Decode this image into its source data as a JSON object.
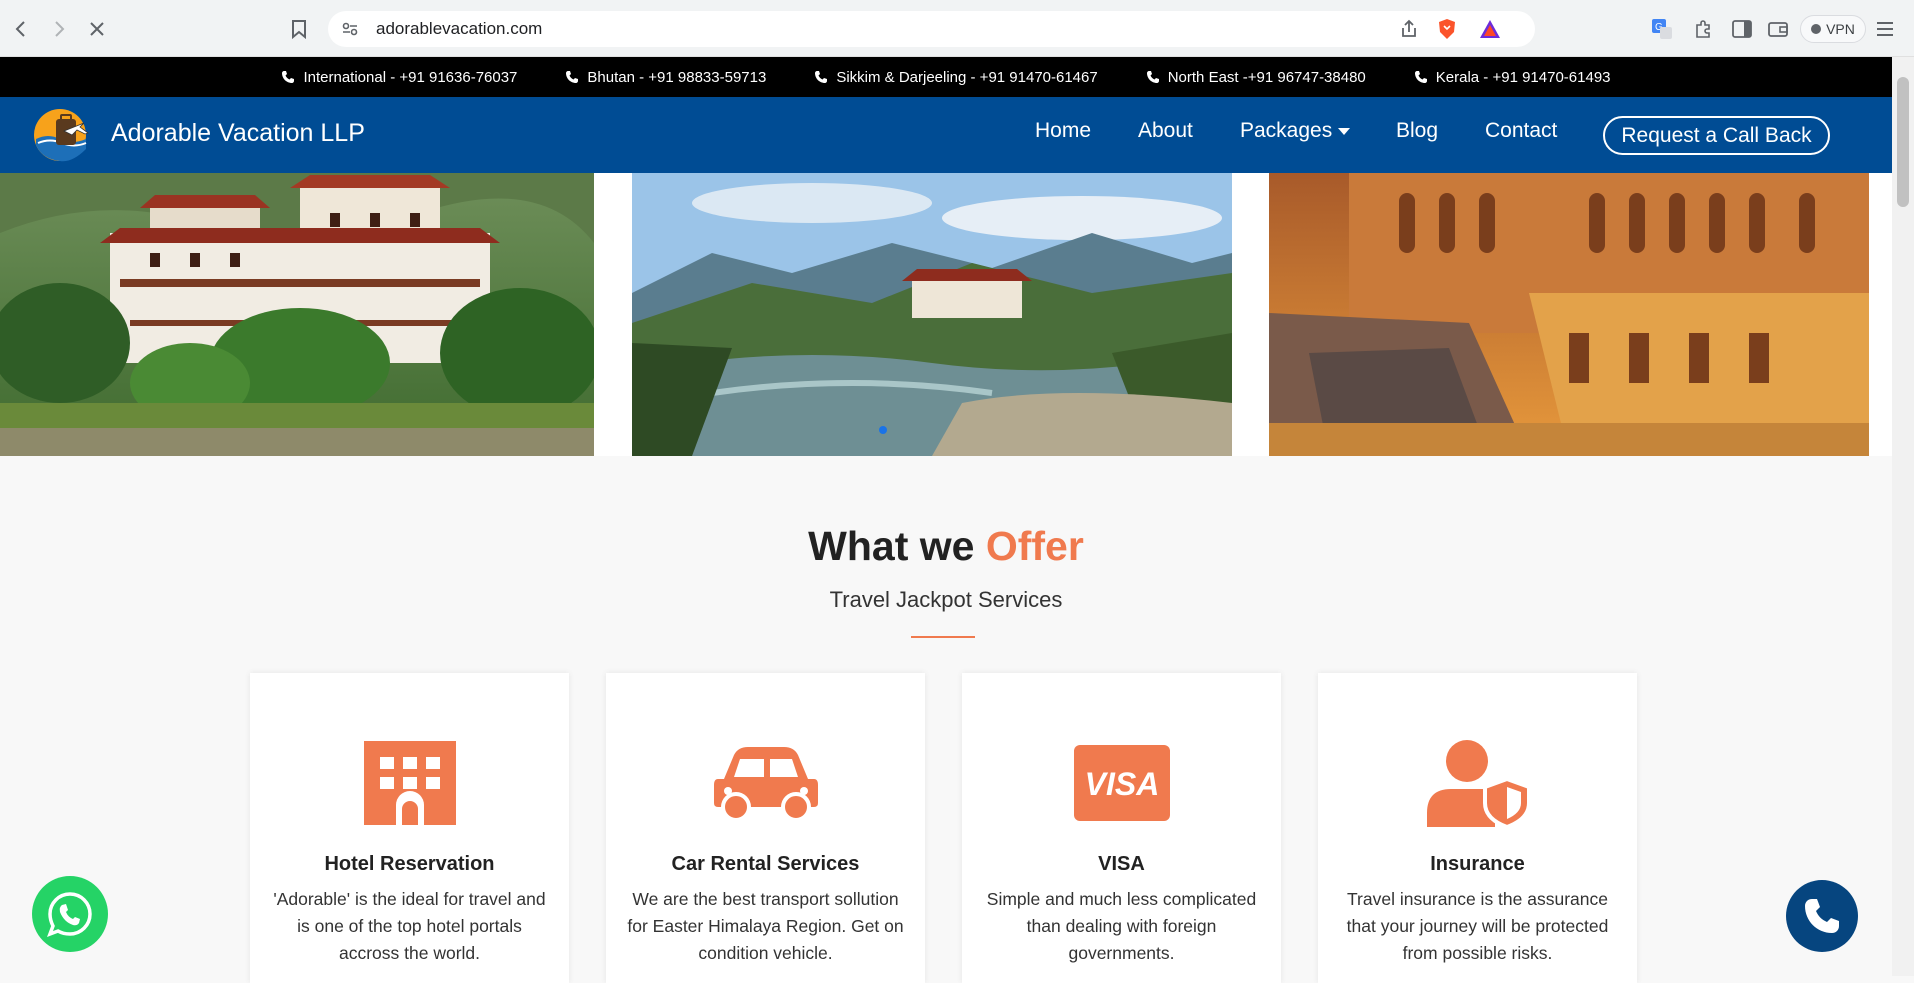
{
  "browser": {
    "url": "adorablevacation.com",
    "vpn_label": "VPN"
  },
  "contact_strip": [
    {
      "label": "International - +91 91636-76037"
    },
    {
      "label": "Bhutan - +91 98833-59713"
    },
    {
      "label": "Sikkim & Darjeeling - +91 91470-61467"
    },
    {
      "label": "North East -+91 96747-38480"
    },
    {
      "label": "Kerala - +91 91470-61493"
    }
  ],
  "header": {
    "brand": "Adorable Vacation LLP",
    "nav": {
      "home": "Home",
      "about": "About",
      "packages": "Packages",
      "blog": "Blog",
      "contact": "Contact"
    },
    "cta": "Request a Call Back"
  },
  "offer": {
    "title_main": "What we",
    "title_accent": "Offer",
    "subtitle": "Travel Jackpot Services"
  },
  "cards": [
    {
      "icon": "hotel-icon",
      "title": "Hotel Reservation",
      "text": "'Adorable' is the ideal for travel and is one of the top hotel portals accross the world."
    },
    {
      "icon": "car-icon",
      "title": "Car Rental Services",
      "text": "We are the best transport sollution for Easter Himalaya Region. Get on condition vehicle."
    },
    {
      "icon": "visa-icon",
      "title": "VISA",
      "text": "Simple and much less complicated than dealing with foreign governments."
    },
    {
      "icon": "insurance-icon",
      "title": "Insurance",
      "text": "Travel insurance is the assurance that your journey will be protected from possible risks."
    }
  ],
  "colors": {
    "header_bg": "#004c94",
    "accent": "#f07a4e",
    "whatsapp": "#25d366",
    "call": "#06457f"
  }
}
